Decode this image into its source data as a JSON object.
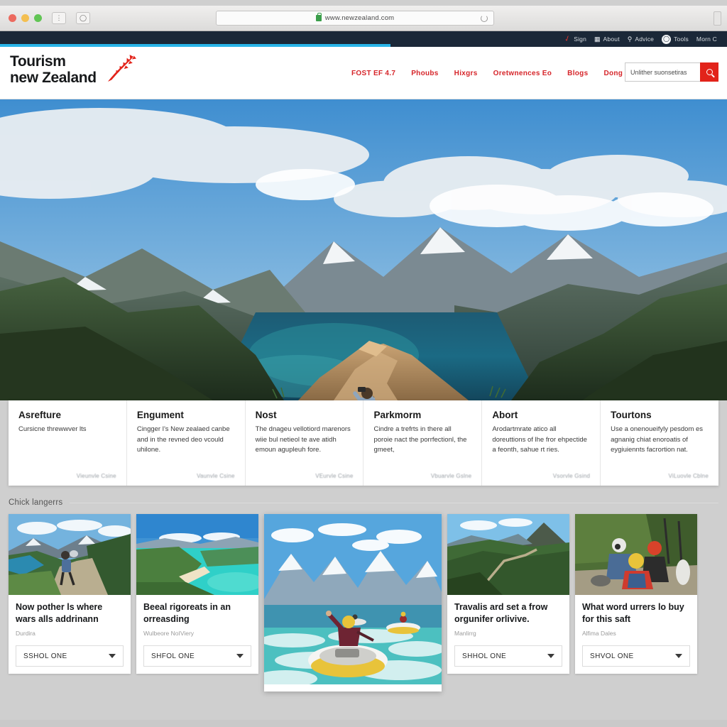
{
  "browser": {
    "traffic_lights": [
      "close",
      "minimize",
      "zoom"
    ],
    "toolbar_buttons": [
      "back-forward-button",
      "refresh-button"
    ],
    "url": "www.newzealand.com",
    "lock_icon": "lock-icon",
    "reload_icon": "reload-icon"
  },
  "utility_bar": {
    "background": "#1b2838",
    "items": [
      {
        "icon": "fern-icon",
        "label": "Sign"
      },
      {
        "icon": "card-icon",
        "label": "About"
      },
      {
        "icon": "pin-icon",
        "label": "Advice"
      },
      {
        "icon": "clock-icon",
        "label": "Tools"
      },
      {
        "icon": "",
        "label": "Morn C"
      }
    ]
  },
  "header": {
    "accent_color": "#29b4e8",
    "logo": {
      "line1": "Tourism",
      "line2": "new Zealand",
      "mark": "silver-fern-icon"
    },
    "nav": [
      {
        "label": "FOST EF 4.7"
      },
      {
        "label": "Phoubs"
      },
      {
        "label": "Hixgrs"
      },
      {
        "label": "Oretwnences Eo"
      },
      {
        "label": "Blogs"
      },
      {
        "label": "Dong"
      }
    ],
    "search": {
      "value": "Unlither suonsetiras",
      "placeholder": "Unlither suonsetiras",
      "button_icon": "search-icon",
      "button_color": "#e2231a"
    }
  },
  "hero": {
    "alt": "Man photographing a teal fjord from a rocky outcrop surrounded by forested mountains"
  },
  "promos": [
    {
      "title": "Asrefture",
      "body": "Cursicne threwwver lts",
      "link": "Vieunvle Csine"
    },
    {
      "title": "Engument",
      "body": "Cingger l’s New zealaed canbe and in the revned deo vcould uhilone.",
      "link": "Vaunvle Csine"
    },
    {
      "title": "Nost",
      "body": "The dnageu vellotiord marenors wiie bul netieol te ave atidh emoun agupleuh fore.",
      "link": "VEurvle Csine"
    },
    {
      "title": "Parkmorm",
      "body": "Cindre a trefrts in there all poroie nact the porrfectionl, the gmeet,",
      "link": "Vbuarvle Gslne"
    },
    {
      "title": "Abort",
      "body": "Arodartmrate atico all doreuttions of lhe fror ehpectide a feonth, sahue rt ries.",
      "link": "Vsorvle Gsind"
    },
    {
      "title": "Tourtons",
      "body": "Use a onenoueifyly pesdom es agnanig chiat enoroatis of eygiuiennts facrortion nat.",
      "link": "ViLuovle Cblne"
    }
  ],
  "section": {
    "title": "Chick langerrs"
  },
  "articles": [
    {
      "title": "Now pother ls where wars alls addrinann",
      "meta": "Durdira",
      "select": "SSHOL ONE",
      "image_alt": "Hiker with backpack walking a grass trail above a lake"
    },
    {
      "title": "Beeal rigoreats in an orreasding",
      "meta": "Wulbeore NoIViery",
      "select": "SHFOL ONE",
      "image_alt": "Turquoise bay with sandy beach and green headland"
    },
    {
      "title": "",
      "meta": "",
      "select": "",
      "image_alt": "Rafters in yellow-and-white inflatable boats on a glacial river below snowy peaks",
      "feature": true
    },
    {
      "title": "Travalis ard set a frow orgunifer orlivive.",
      "meta": "Manlirrg",
      "select": "SHHOL ONE",
      "image_alt": "Winding trail across a green ridge with mountain behind"
    },
    {
      "title": "What word urrers lo buy for this saft",
      "meta": "Alfima Dales",
      "select": "SHVOL ONE",
      "image_alt": "Group in helmets and life vests preparing gear on a gravel track"
    }
  ]
}
